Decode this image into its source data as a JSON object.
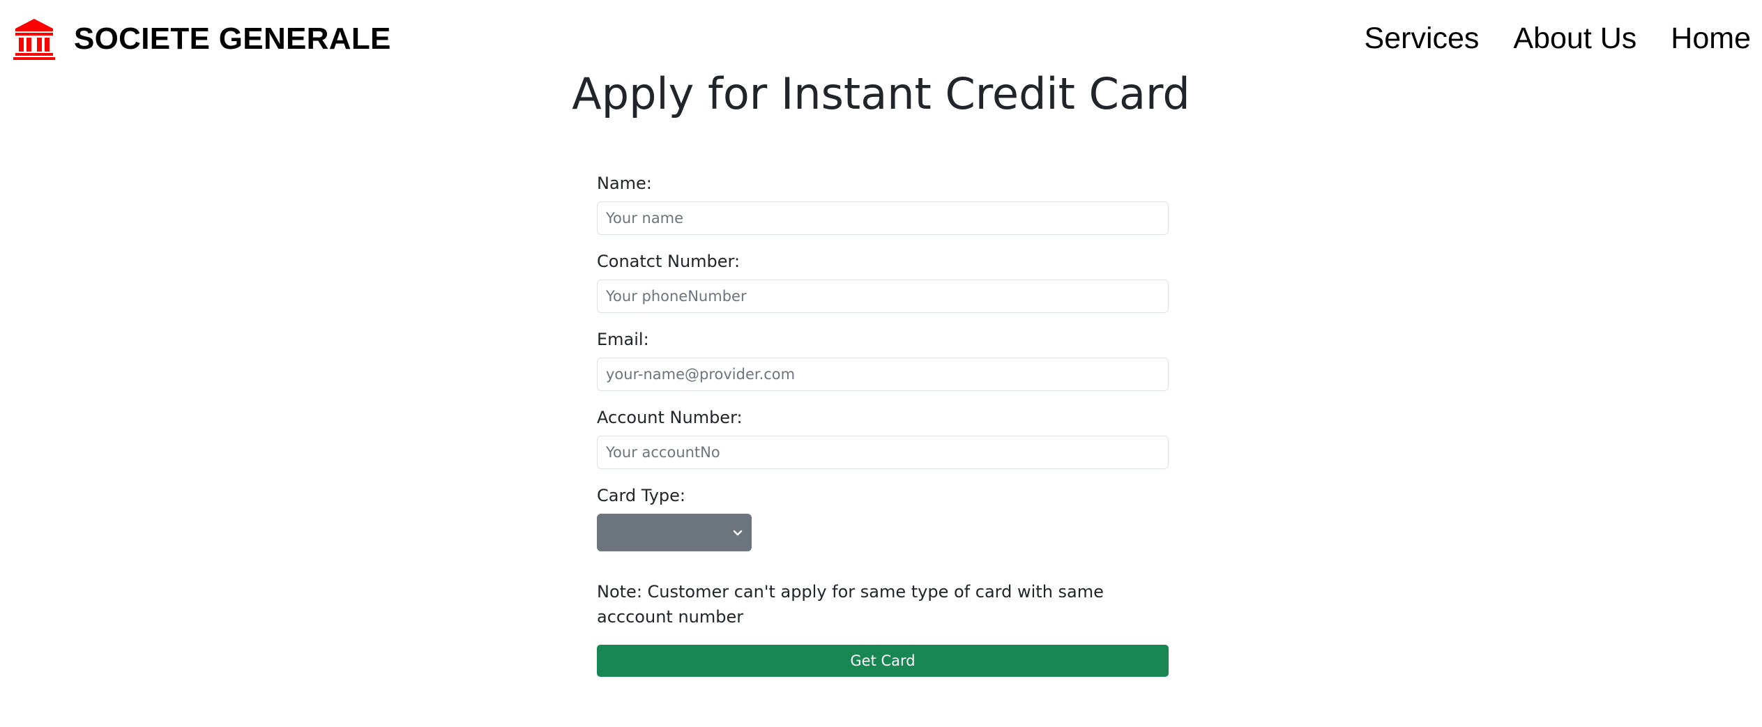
{
  "header": {
    "brand_name": "SOCIETE GENERALE",
    "brand_icon": "bank-icon",
    "brand_color": "#ff0000",
    "nav": [
      {
        "label": "Services"
      },
      {
        "label": "About Us"
      },
      {
        "label": "Home"
      }
    ]
  },
  "page": {
    "title": "Apply for Instant Credit Card"
  },
  "form": {
    "name": {
      "label": "Name:",
      "placeholder": "Your name",
      "value": ""
    },
    "contact": {
      "label": "Conatct Number:",
      "placeholder": "Your phoneNumber",
      "value": ""
    },
    "email": {
      "label": "Email:",
      "placeholder": "your-name@provider.com",
      "value": ""
    },
    "account": {
      "label": "Account Number:",
      "placeholder": "Your accountNo",
      "value": ""
    },
    "card_type": {
      "label": "Card Type:",
      "selected": "",
      "icon": "chevron-down-icon",
      "color": "#6c757d"
    },
    "note": "Note: Customer can't apply for same type of card with same acccount number",
    "submit_label": "Get Card",
    "submit_color": "#198754"
  }
}
